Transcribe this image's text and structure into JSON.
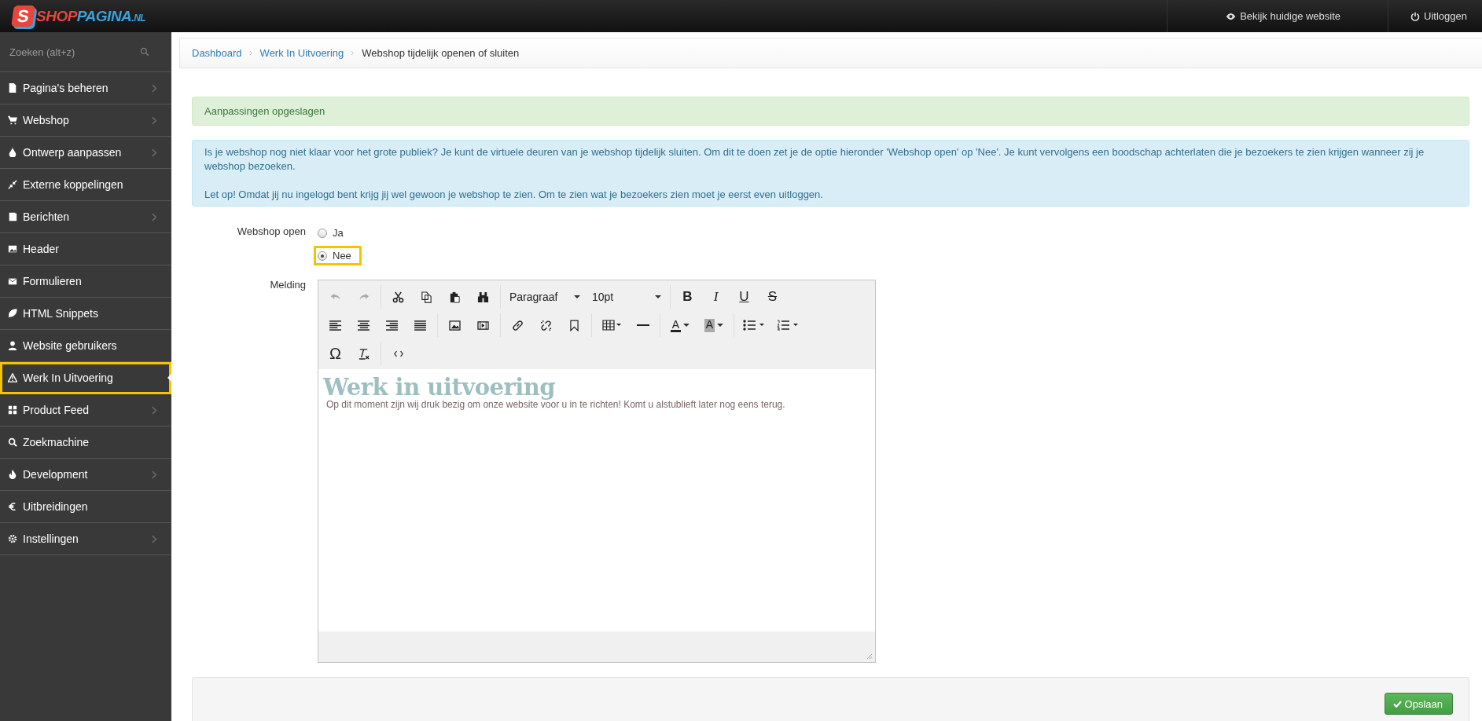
{
  "logo": {
    "mark": "S",
    "part1": "SHOP",
    "part2": "PAGINA",
    "suffix": ".NL"
  },
  "topbar": {
    "links": [
      "Bekijk huidige website",
      "Uitloggen"
    ]
  },
  "sidebar": {
    "search": {
      "placeholder": "Zoeken (alt+z)"
    },
    "items": [
      {
        "label": "Pagina's beheren",
        "has_submenu": true,
        "selected": false
      },
      {
        "label": "Webshop",
        "has_submenu": true,
        "selected": false
      },
      {
        "label": "Ontwerp aanpassen",
        "has_submenu": true,
        "selected": false
      },
      {
        "label": "Externe koppelingen",
        "has_submenu": false,
        "selected": false
      },
      {
        "label": "Berichten",
        "has_submenu": true,
        "selected": false
      },
      {
        "label": "Header",
        "has_submenu": false,
        "selected": false
      },
      {
        "label": "Formulieren",
        "has_submenu": false,
        "selected": false
      },
      {
        "label": "HTML Snippets",
        "has_submenu": false,
        "selected": false
      },
      {
        "label": "Website gebruikers",
        "has_submenu": false,
        "selected": false
      },
      {
        "label": "Werk In Uitvoering",
        "has_submenu": false,
        "selected": true
      },
      {
        "label": "Product Feed",
        "has_submenu": true,
        "selected": false
      },
      {
        "label": "Zoekmachine",
        "has_submenu": false,
        "selected": false
      },
      {
        "label": "Development",
        "has_submenu": true,
        "selected": false
      },
      {
        "label": "Uitbreidingen",
        "has_submenu": false,
        "selected": false
      },
      {
        "label": "Instellingen",
        "has_submenu": true,
        "selected": false
      }
    ]
  },
  "breadcrumb": [
    "Dashboard",
    "Werk In Uitvoering",
    "Webshop tijdelijk openen of sluiten"
  ],
  "success_alert": "Aanpassingen opgeslagen",
  "info_alert": [
    "Is je webshop nog niet klaar voor het grote publiek? Je kunt de virtuele deuren van je webshop tijdelijk sluiten. Om dit te doen zet je de optie hieronder 'Webshop open' op 'Nee'. Je kunt vervolgens een boodschap achterlaten die je bezoekers te zien krijgen wanneer zij je webshop bezoeken.",
    "Let op! Omdat jij nu ingelogd bent krijg jij wel gewoon je webshop te zien. Om te zien wat je bezoekers zien moet je eerst even uitloggen."
  ],
  "form": {
    "webshop_open": {
      "label": "Webshop open",
      "options": [
        {
          "label": "Ja",
          "selected": false
        },
        {
          "label": "Nee",
          "selected": true
        }
      ]
    },
    "melding": {
      "label": "Melding",
      "block_format": "Paragraaf",
      "font_size": "10pt",
      "format_buttons": [
        "B",
        "I",
        "U",
        "S"
      ],
      "text_color": "A",
      "background_color": "A",
      "special_char": "Ω",
      "heading": "Werk in uitvoering",
      "body": "Op dit moment zijn wij druk bezig om onze website voor u in te richten! Komt u alstublieft later nog eens terug."
    }
  },
  "save_button": "Opslaan"
}
